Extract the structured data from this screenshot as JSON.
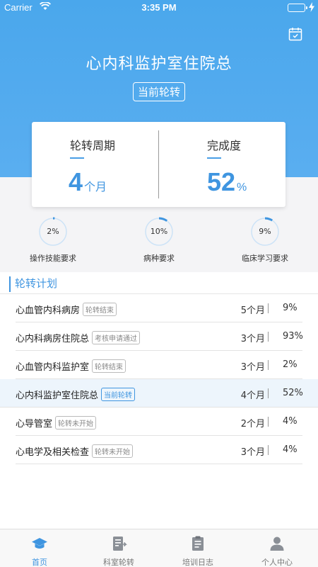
{
  "status_bar": {
    "carrier": "Carrier",
    "time": "3:35 PM"
  },
  "header": {
    "title": "心内科监护室住院总",
    "badge": "当前轮转"
  },
  "summary": {
    "period_label": "轮转周期",
    "period_value": "4",
    "period_unit": "个月",
    "completion_label": "完成度",
    "completion_value": "52",
    "completion_unit": "%"
  },
  "progress": [
    {
      "pct": "2%",
      "value": 0.02,
      "label": "操作技能要求"
    },
    {
      "pct": "10%",
      "value": 0.1,
      "label": "病种要求"
    },
    {
      "pct": "9%",
      "value": 0.09,
      "label": "临床学习要求"
    }
  ],
  "plan": {
    "title": "轮转计划",
    "rows": [
      {
        "name": "心血管内科病房",
        "tag": "轮转结束",
        "period": "5个月",
        "rate": "9%"
      },
      {
        "name": "心内科病房住院总",
        "tag": "考核申请通过",
        "period": "3个月",
        "rate": "93%"
      },
      {
        "name": "心血管内科监护室",
        "tag": "轮转结束",
        "period": "3个月",
        "rate": "2%"
      },
      {
        "name": "心内科监护室住院总",
        "tag": "当前轮转",
        "period": "4个月",
        "rate": "52%"
      },
      {
        "name": "心导管室",
        "tag": "轮转未开始",
        "period": "2个月",
        "rate": "4%"
      },
      {
        "name": "心电学及相关检查",
        "tag": "轮转未开始",
        "period": "3个月",
        "rate": "4%"
      }
    ]
  },
  "tabbar": {
    "items": [
      {
        "label": "首页",
        "icon": "graduation-cap-icon"
      },
      {
        "label": "科室轮转",
        "icon": "rotation-icon"
      },
      {
        "label": "培训日志",
        "icon": "clipboard-icon"
      },
      {
        "label": "个人中心",
        "icon": "person-icon"
      }
    ]
  },
  "colors": {
    "accent": "#3f95e0",
    "header": "#4aa7ec",
    "muted": "#888888"
  }
}
